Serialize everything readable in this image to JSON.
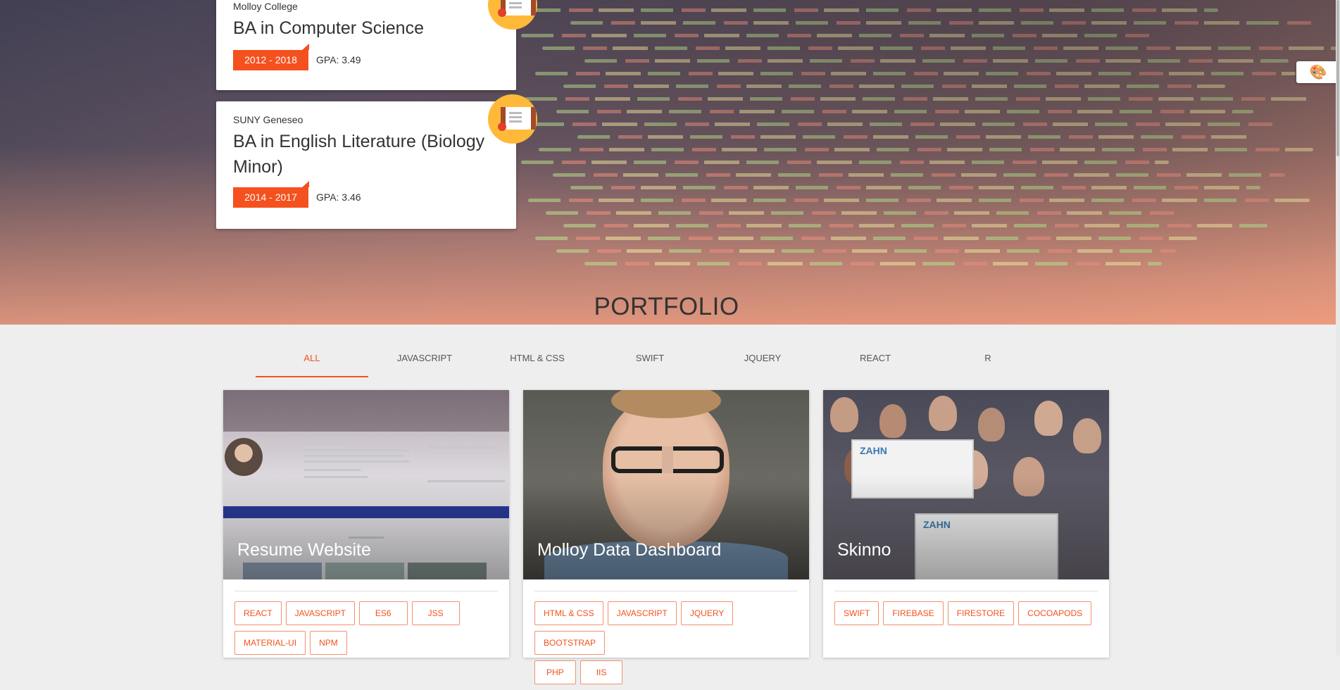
{
  "education": [
    {
      "school": "Molloy College",
      "degree": "BA in Computer Science",
      "years": "2012 - 2018",
      "gpa": "GPA: 3.49"
    },
    {
      "school": "SUNY Geneseo",
      "degree": "BA in English Literature (Biology Minor)",
      "years": "2014 - 2017",
      "gpa": "GPA: 3.46"
    }
  ],
  "portfolio": {
    "title": "PORTFOLIO",
    "tabs": [
      "ALL",
      "JAVASCRIPT",
      "HTML & CSS",
      "SWIFT",
      "JQUERY",
      "REACT",
      "R"
    ],
    "active_tab": "ALL",
    "projects": [
      {
        "title": "Resume Website",
        "tags": [
          "REACT",
          "JAVASCRIPT",
          "ES6",
          "JSS",
          "MATERIAL-UI",
          "NPM"
        ]
      },
      {
        "title": "Molloy Data Dashboard",
        "tags": [
          "HTML & CSS",
          "JAVASCRIPT",
          "JQUERY",
          "BOOTSTRAP",
          "PHP",
          "IIS"
        ]
      },
      {
        "title": "Skinno",
        "tags": [
          "SWIFT",
          "FIREBASE",
          "FIRESTORE",
          "COCOAPODS"
        ]
      }
    ]
  },
  "icons": {
    "palette": "palette-icon",
    "degree_badge": "certificate-icon"
  },
  "colors": {
    "accent": "#f4511e",
    "badge": "#ffb93a"
  }
}
